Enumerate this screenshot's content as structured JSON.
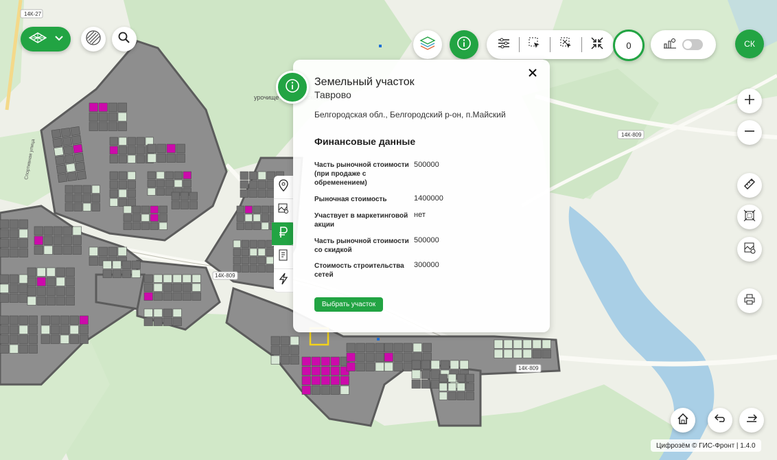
{
  "map": {
    "road_labels": [
      "14К-27",
      "14К-809",
      "14К-809",
      "14К-809"
    ],
    "place_labels": [
      "урочище Кручиновское",
      "Спортивная улица"
    ],
    "colors": {
      "water": "#a9cfe6",
      "forest": "#cfe6c6",
      "plot_dark": "#707070",
      "plot_light": "#d8e8d6",
      "plot_highlight": "#cc0aab",
      "road": "#fafaf5",
      "accent": "#22a443"
    }
  },
  "toolbar": {
    "layers_icon": "layers-diamond-icon",
    "hatch_icon": "hatch-icon",
    "search_icon": "search-icon",
    "stack_icon": "layer-stack-icon",
    "info_icon": "info-icon",
    "tools": [
      "filter-icon",
      "select-arrow-icon",
      "select-box-icon",
      "collapse-icon"
    ],
    "counter_value": "0",
    "chart_icon": "bar-chart-icon",
    "user_initials": "СК"
  },
  "panel": {
    "title": "Земельный участок",
    "subtitle": "Таврово",
    "address": "Белгородская обл., Белгородский р-он, п.Майский",
    "section_title": "Финансовые данные",
    "rows": [
      {
        "label": "Часть рыночной стоимости (при продаже с обременением)",
        "value": "500000"
      },
      {
        "label": "Рыночная стоимость",
        "value": "1400000"
      },
      {
        "label": "Участвует в маркетинговой акции",
        "value": "нет"
      },
      {
        "label": "Часть рыночной стоимости со скидкой",
        "value": "500000"
      },
      {
        "label": "Стоимость строительства сетей",
        "value": "300000"
      }
    ],
    "select_button": "Выбрать участок"
  },
  "side_tabs": [
    "pin-icon",
    "map-image-icon",
    "ruble-icon",
    "document-icon",
    "lightning-icon"
  ],
  "right_controls": [
    "zoom-in-icon",
    "zoom-out-icon",
    "ruler-icon",
    "frame-select-icon",
    "map-image-icon",
    "print-icon"
  ],
  "bottom_controls": [
    "home-icon",
    "undo-icon",
    "redo-icon"
  ],
  "footer": {
    "copyright": "Цифрозём © ГИС-Фронт | 1.4.0"
  }
}
